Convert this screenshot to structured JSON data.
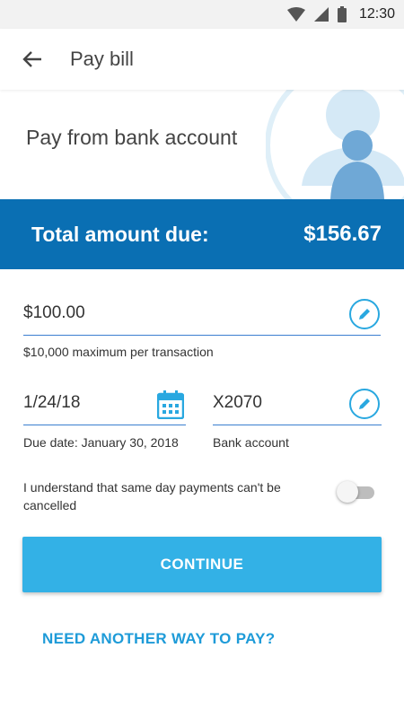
{
  "status_bar": {
    "time": "12:30"
  },
  "app_bar": {
    "title": "Pay bill"
  },
  "header": {
    "title": "Pay from bank account"
  },
  "total": {
    "label": "Total amount due:",
    "amount": "$156.67"
  },
  "amount_field": {
    "value": "$100.00",
    "helper": "$10,000 maximum per transaction"
  },
  "date_field": {
    "value": "1/24/18",
    "helper": "Due date: January 30, 2018"
  },
  "account_field": {
    "value": "X2070",
    "helper": "Bank account"
  },
  "consent": {
    "text": "I understand  that same day payments can't be cancelled",
    "enabled": false
  },
  "actions": {
    "continue": "CONTINUE",
    "other_way": "NEED ANOTHER WAY TO PAY?"
  },
  "colors": {
    "primary_dark": "#0a6fb3",
    "accent": "#33b1e6",
    "link": "#1e9bd8"
  }
}
